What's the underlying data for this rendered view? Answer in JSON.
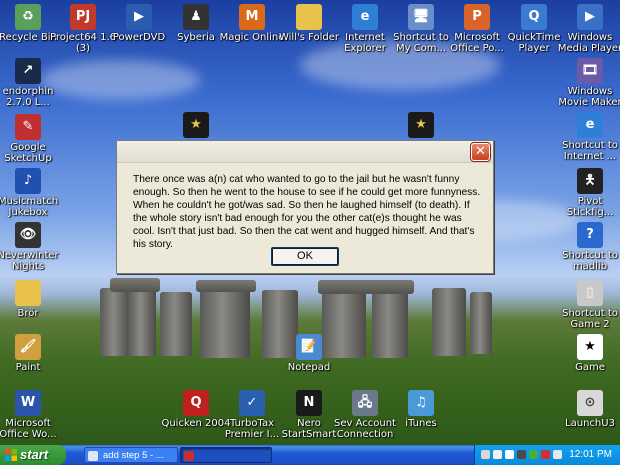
{
  "desktop_icons": [
    {
      "label": "Recycle Bin",
      "icon": "recycle-bin-icon",
      "color": "#5aa05a",
      "glyph": "♻"
    },
    {
      "label": "Project64 1.6 (3)",
      "icon": "project64-icon",
      "color": "#c0392b",
      "glyph": "PJ"
    },
    {
      "label": "PowerDVD",
      "icon": "powerdvd-icon",
      "color": "#2a5db0",
      "glyph": "▶"
    },
    {
      "label": "Syberia",
      "icon": "syberia-icon",
      "color": "#333333",
      "glyph": "♟"
    },
    {
      "label": "Magic Online",
      "icon": "magic-online-icon",
      "color": "#d86a1a",
      "glyph": "M"
    },
    {
      "label": "Will's Folder",
      "icon": "folder-icon",
      "color": "#e8c24a",
      "glyph": ""
    },
    {
      "label": "Internet Explorer",
      "icon": "internet-explorer-icon",
      "color": "#2f7fd6",
      "glyph": "e"
    },
    {
      "label": "Shortcut to My Com...",
      "icon": "my-computer-icon",
      "color": "#6a8fc8",
      "glyph": "🖥"
    },
    {
      "label": "Microsoft Office Po...",
      "icon": "powerpoint-icon",
      "color": "#d9642a",
      "glyph": "P"
    },
    {
      "label": "QuickTime Player",
      "icon": "quicktime-icon",
      "color": "#3a7ad0",
      "glyph": "Q"
    },
    {
      "label": "Windows Media Player",
      "icon": "media-player-icon",
      "color": "#3a70c8",
      "glyph": "▶"
    },
    {
      "label": "endorphin 2.7.0 L...",
      "icon": "endorphin-icon",
      "color": "#1a2a4a",
      "glyph": "↗"
    },
    {
      "label": "Windows Movie Maker",
      "icon": "movie-maker-icon",
      "color": "#6a5aa8",
      "glyph": "🎞"
    },
    {
      "label": "Google SketchUp",
      "icon": "sketchup-icon",
      "color": "#c03030",
      "glyph": "✎"
    },
    {
      "label": "Shortcut to Internet ...",
      "icon": "internet-explorer-icon",
      "color": "#2f7fd6",
      "glyph": "e"
    },
    {
      "label": "Musicmatch Jukebox",
      "icon": "musicmatch-icon",
      "color": "#2050b0",
      "glyph": "♪"
    },
    {
      "label": "Pivot Stickfig...",
      "icon": "pivot-icon",
      "color": "#222222",
      "glyph": "🯅"
    },
    {
      "label": "Neverwinter Nights",
      "icon": "neverwinter-icon",
      "color": "#333333",
      "glyph": "👁"
    },
    {
      "label": "Shortcut to madlib",
      "icon": "help-icon",
      "color": "#2a6ad0",
      "glyph": "?"
    },
    {
      "label": "Brör",
      "icon": "folder-icon",
      "color": "#e8c24a",
      "glyph": ""
    },
    {
      "label": "Shortcut to Game 2",
      "icon": "game-icon",
      "color": "#c8c8c8",
      "glyph": "▯"
    },
    {
      "label": "Paint",
      "icon": "paint-icon",
      "color": "#d0a040",
      "glyph": "🖌"
    },
    {
      "label": "Notepad",
      "icon": "notepad-icon",
      "color": "#4a8ad0",
      "glyph": "📝"
    },
    {
      "label": "Game",
      "icon": "star-icon",
      "color": "#ffffff",
      "glyph": "★"
    },
    {
      "label": "Microsoft Office Wo...",
      "icon": "word-icon",
      "color": "#2a55a8",
      "glyph": "W"
    },
    {
      "label": "Quicken 2004",
      "icon": "quicken-icon",
      "color": "#c02020",
      "glyph": "Q"
    },
    {
      "label": "TurboTax Premier I...",
      "icon": "turbotax-icon",
      "color": "#2a60b0",
      "glyph": "✓"
    },
    {
      "label": "Nero StartSmart",
      "icon": "nero-icon",
      "color": "#1a1a1a",
      "glyph": "N"
    },
    {
      "label": "Sev Account Connection",
      "icon": "network-icon",
      "color": "#6a7a8a",
      "glyph": "🖧"
    },
    {
      "label": "iTunes",
      "icon": "itunes-icon",
      "color": "#4a9ad8",
      "glyph": "♫"
    },
    {
      "label": "LaunchU3",
      "icon": "launchu3-icon",
      "color": "#d8d8d8",
      "glyph": "⊙"
    }
  ],
  "dialog": {
    "message": "There once was a(n) cat who wanted to go to the jail but he wasn't funny enough. So then he went to the house to see if he could get more funnyness. When he couldn't he got/was sad. So then he laughed himself (to death). If the whole story isn't bad enough for you the other cat(e)s thought he was cool. Isn't that just bad. So then the cat went and hugged himself. And that's his story.",
    "ok_label": "OK",
    "close_glyph": "✕"
  },
  "taskbar": {
    "start_label": "start",
    "tasks": [
      {
        "label": "add step 5 - ...",
        "active": false
      },
      {
        "label": "",
        "active": true
      }
    ],
    "clock": "12:01 PM"
  },
  "colors": {
    "taskbar_blue": "#2157d7",
    "start_green": "#379a37",
    "tray_blue": "#0b8ad8",
    "dialog_face": "#ece9d8",
    "close_red": "#c8401f"
  }
}
